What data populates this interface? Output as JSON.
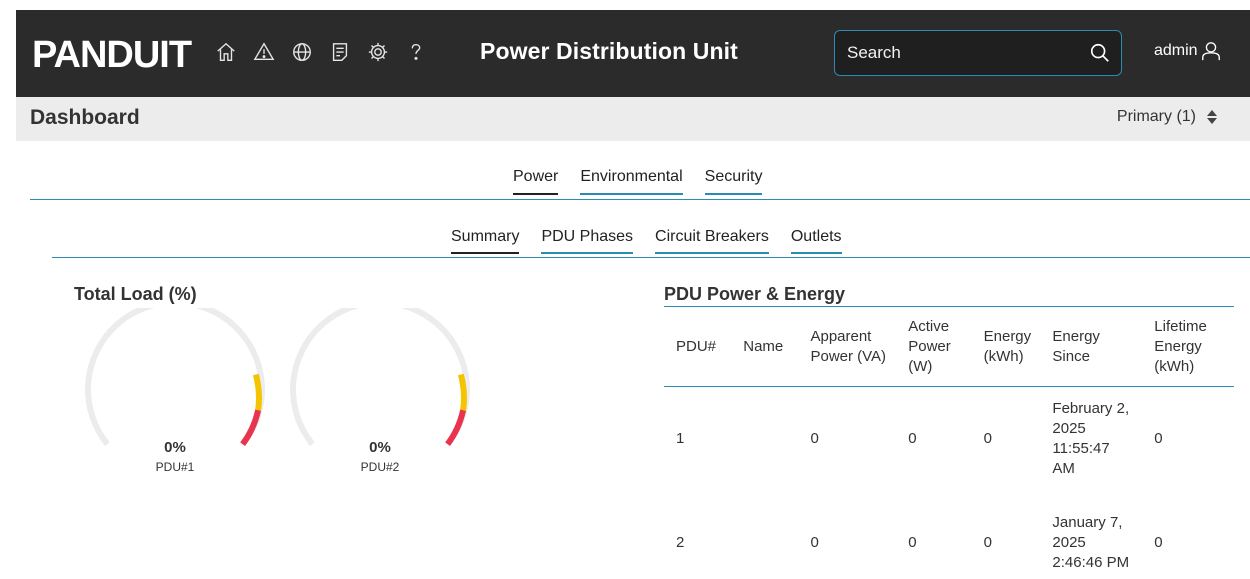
{
  "header": {
    "logo_text": "PANDUIT",
    "icons": [
      "home-icon",
      "alert-icon",
      "globe-icon",
      "log-icon",
      "settings-icon",
      "help-icon"
    ],
    "title": "Power Distribution Unit",
    "search_placeholder": "Search",
    "user_label": "admin"
  },
  "page": {
    "title": "Dashboard",
    "unit_selector": "Primary (1)"
  },
  "main_tabs": [
    {
      "label": "Power",
      "active": true
    },
    {
      "label": "Environmental",
      "active": false
    },
    {
      "label": "Security",
      "active": false
    }
  ],
  "sub_tabs": [
    {
      "label": "Summary",
      "active": true
    },
    {
      "label": "PDU Phases",
      "active": false
    },
    {
      "label": "Circuit Breakers",
      "active": false
    },
    {
      "label": "Outlets",
      "active": false
    }
  ],
  "total_load": {
    "title": "Total Load (%)",
    "gauges": [
      {
        "value": "0%",
        "label": "PDU#1",
        "load": 0
      },
      {
        "value": "0%",
        "label": "PDU#2",
        "load": 0
      }
    ]
  },
  "energy": {
    "title": "PDU Power & Energy",
    "columns": [
      "PDU#",
      "Name",
      "Apparent Power (VA)",
      "Active Power (W)",
      "Energy (kWh)",
      "Energy Since",
      "Lifetime Energy (kWh)"
    ],
    "rows": [
      [
        "1",
        "",
        "0",
        "0",
        "0",
        "February 2, 2025 11:55:47 AM",
        "0"
      ],
      [
        "2",
        "",
        "0",
        "0",
        "0",
        "January 7, 2025 2:46:46 PM",
        "0"
      ]
    ]
  },
  "colors": {
    "header_bg": "#2b2b2b",
    "accent": "#2b8bb0",
    "gauge_track": "#ececec",
    "gauge_warning": "#f5c400",
    "gauge_critical": "#e8344e"
  }
}
